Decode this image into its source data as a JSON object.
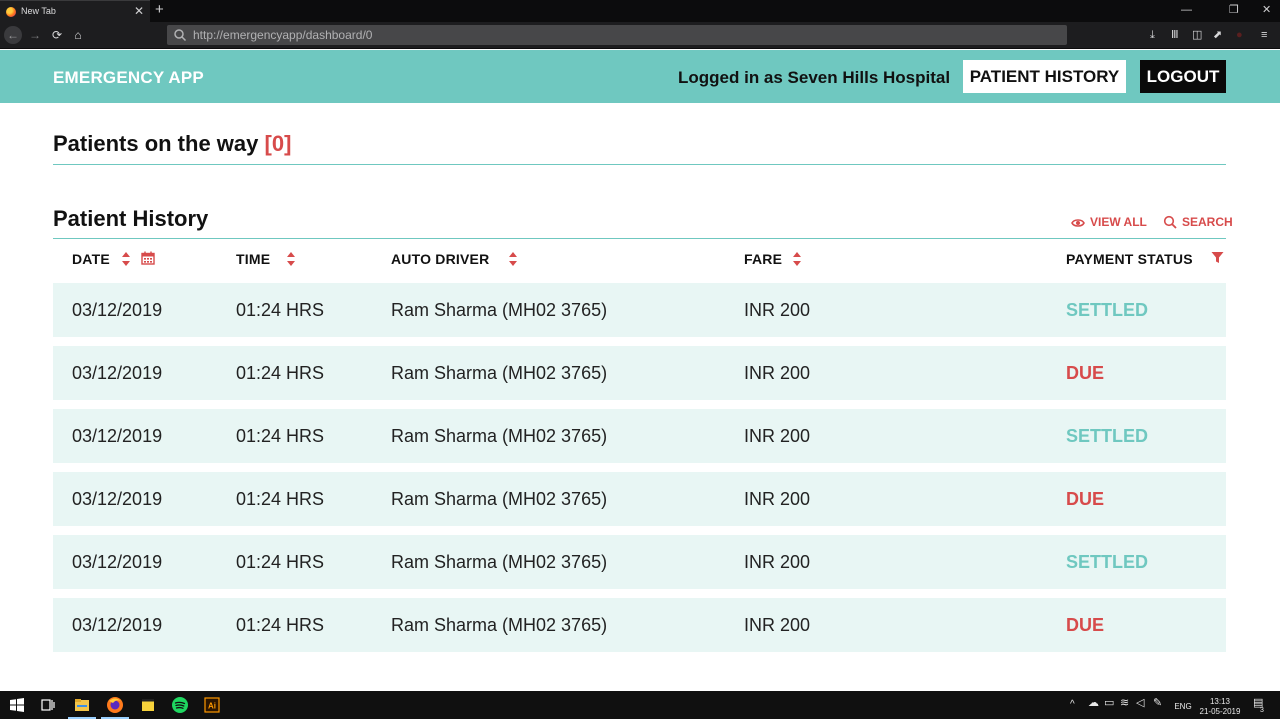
{
  "browser": {
    "tab_title": "New Tab",
    "url": "http://emergencyapp/dashboard/0"
  },
  "header": {
    "brand": "EMERGENCY APP",
    "logged_in_text": "Logged in as Seven Hills Hospital",
    "history_button": "PATIENT HISTORY",
    "logout_button": "LOGOUT"
  },
  "on_the_way": {
    "title": "Patients on the way",
    "count": "[0]"
  },
  "history": {
    "title": "Patient History",
    "view_all": "VIEW ALL",
    "search": "SEARCH",
    "columns": {
      "date": "DATE",
      "time": "TIME",
      "driver": "AUTO DRIVER",
      "fare": "FARE",
      "payment": "PAYMENT STATUS"
    },
    "rows": [
      {
        "date": "03/12/2019",
        "time": "01:24 HRS",
        "driver": "Ram Sharma (MH02 3765)",
        "fare": "INR 200",
        "status": "SETTLED"
      },
      {
        "date": "03/12/2019",
        "time": "01:24 HRS",
        "driver": "Ram Sharma (MH02 3765)",
        "fare": "INR 200",
        "status": "DUE"
      },
      {
        "date": "03/12/2019",
        "time": "01:24 HRS",
        "driver": "Ram Sharma (MH02 3765)",
        "fare": "INR 200",
        "status": "SETTLED"
      },
      {
        "date": "03/12/2019",
        "time": "01:24 HRS",
        "driver": "Ram Sharma (MH02 3765)",
        "fare": "INR 200",
        "status": "DUE"
      },
      {
        "date": "03/12/2019",
        "time": "01:24 HRS",
        "driver": "Ram Sharma (MH02 3765)",
        "fare": "INR 200",
        "status": "SETTLED"
      },
      {
        "date": "03/12/2019",
        "time": "01:24 HRS",
        "driver": "Ram Sharma (MH02 3765)",
        "fare": "INR 200",
        "status": "DUE"
      }
    ]
  },
  "colors": {
    "accent": "#6fc8c0",
    "row_bg": "#e8f6f4",
    "due": "#d74b4b",
    "settled": "#6fc8c0"
  },
  "taskbar": {
    "language": "ENG",
    "clock_time": "13:13",
    "clock_date": "21-05-2019",
    "notification_count": "3",
    "icons": [
      "windows-start-icon",
      "file-explorer-icon",
      "firefox-icon",
      "sticky-notes-icon",
      "spotify-icon",
      "illustrator-icon"
    ]
  }
}
